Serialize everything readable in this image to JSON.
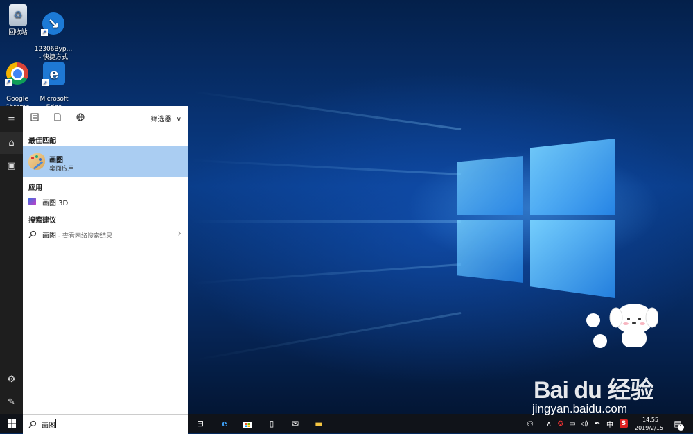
{
  "desktop": {
    "icons": [
      {
        "label": "回收站",
        "icon": "recycle-bin-icon"
      },
      {
        "label": "12306Byp...\n- 快捷方式",
        "icon": "12306-shortcut-icon"
      },
      {
        "label": "Google\nChrome",
        "icon": "chrome-icon"
      },
      {
        "label": "Microsoft\nEdge",
        "icon": "edge-icon"
      }
    ]
  },
  "start_menu": {
    "rail": [
      {
        "icon": "hamburger-menu-icon",
        "glyph": "≡"
      },
      {
        "icon": "home-icon",
        "glyph": "⌂"
      },
      {
        "icon": "notebook-icon",
        "glyph": "▣"
      },
      {
        "icon": "settings-gear-icon",
        "glyph": "⚙"
      },
      {
        "icon": "feedback-icon",
        "glyph": "✎"
      }
    ],
    "toolbar": {
      "filter_label": "筛选器",
      "filter_chevron": "∨"
    },
    "sections": {
      "best_match": "最佳匹配",
      "apps": "应用",
      "suggestions": "搜索建议"
    },
    "best_match_item": {
      "title": "画图",
      "subtitle": "桌面应用"
    },
    "apps_items": [
      {
        "label": "画图 3D"
      }
    ],
    "suggestion_items": [
      {
        "label": "画图",
        "sub": " - 查看网络搜索结果",
        "chevron": "›"
      }
    ]
  },
  "search_box": {
    "value": "画图"
  },
  "taskbar": {
    "clock_time": "14:55",
    "clock_date": "2019/2/15",
    "ime": "中",
    "notifications_count": "1"
  },
  "watermark": {
    "brand": "Bai du 经验",
    "url": "jingyan.baidu.com"
  },
  "colors": {
    "accent_highlight": "#aacdf2",
    "start_rail": "#1e1e1e",
    "taskbar": "#101319"
  }
}
